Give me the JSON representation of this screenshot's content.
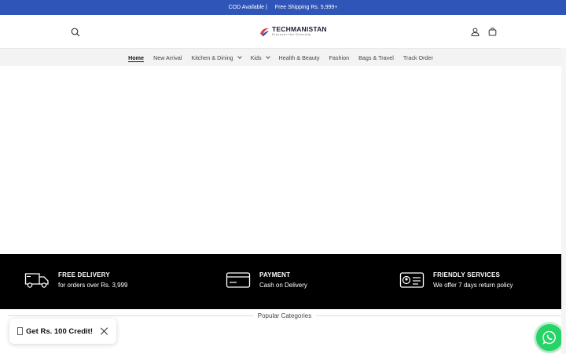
{
  "announcement": {
    "cod": "COD Available |",
    "shipping": "Free Shipping Rs. 5,999+"
  },
  "header": {
    "logo_name": "TECHMANISTAN",
    "logo_tagline": "Discover the Diversity"
  },
  "nav": {
    "items": [
      {
        "label": "Home",
        "active": true,
        "has_dropdown": false
      },
      {
        "label": "New Arrival",
        "active": false,
        "has_dropdown": false
      },
      {
        "label": "Kitchen & Dining",
        "active": false,
        "has_dropdown": true
      },
      {
        "label": "Kids",
        "active": false,
        "has_dropdown": true
      },
      {
        "label": "Health & Beauty",
        "active": false,
        "has_dropdown": false
      },
      {
        "label": "Fashion",
        "active": false,
        "has_dropdown": false
      },
      {
        "label": "Bags & Travel",
        "active": false,
        "has_dropdown": false
      },
      {
        "label": "Track Order",
        "active": false,
        "has_dropdown": false
      }
    ]
  },
  "features": [
    {
      "icon": "delivery-truck-icon",
      "title": "FREE DELIVERY",
      "desc": "for orders over Rs. 3,999"
    },
    {
      "icon": "credit-card-icon",
      "title": "PAYMENT",
      "desc": "Cash on Delivery"
    },
    {
      "icon": "id-card-icon",
      "title": "FRIENDLY SERVICES",
      "desc": "We offer 7 days return policy"
    }
  ],
  "popular": {
    "title": "Popular Categories"
  },
  "credit_popup": {
    "text": "Get Rs. 100 Credit!"
  },
  "colors": {
    "announcement_bg": "#2f55b8",
    "features_bg": "#000000",
    "whatsapp": "#25d366"
  }
}
